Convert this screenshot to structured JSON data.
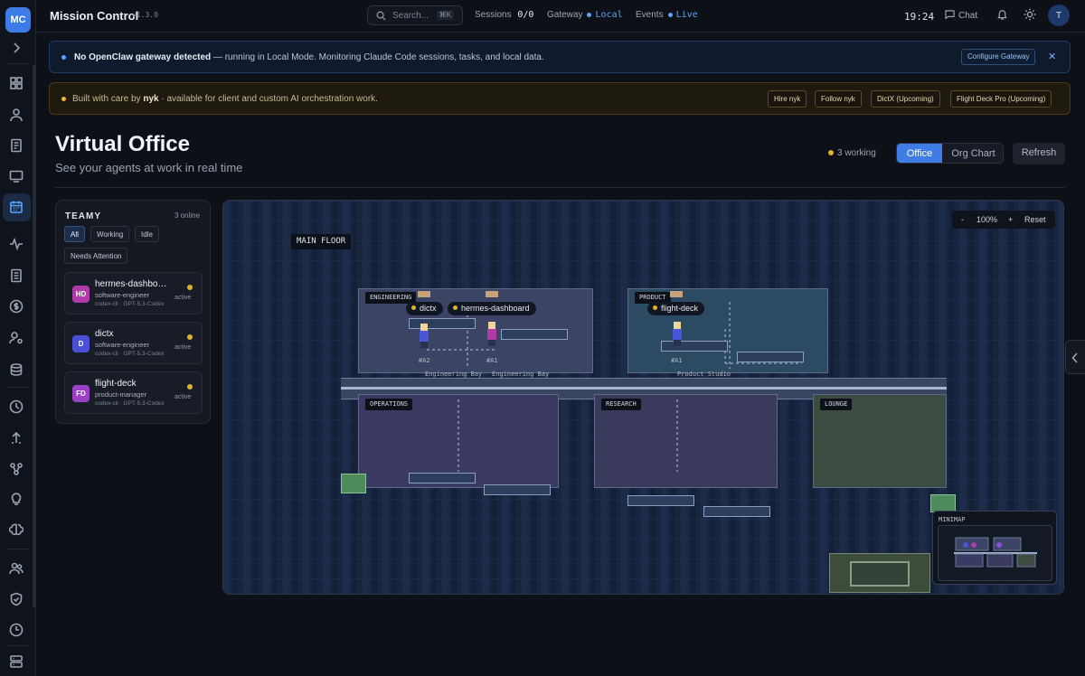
{
  "app": {
    "logo": "MC",
    "title": "Mission Control",
    "version": "v1.3.0"
  },
  "topbar": {
    "search_placeholder": "Search...",
    "search_shortcut": "⌘K",
    "sessions_label": "Sessions",
    "sessions_value": "0/0",
    "gateway_label": "Gateway",
    "gateway_value": "Local",
    "events_label": "Events",
    "events_value": "Live",
    "clock": "19:24",
    "chat_label": "Chat",
    "user_initial": "T"
  },
  "banner_gateway": {
    "title": "No OpenClaw gateway detected",
    "text": " — running in Local Mode. Monitoring Claude Code sessions, tasks, and local data.",
    "button": "Configure Gateway",
    "close": "✕"
  },
  "banner_credit": {
    "prefix": "Built with care by ",
    "author": "nyk",
    "suffix": " · available for client and custom AI orchestration work.",
    "buttons": [
      "Hire nyk",
      "Follow nyk",
      "DictX (Upcoming)",
      "Flight Deck Pro (Upcoming)"
    ]
  },
  "page": {
    "title": "Virtual Office",
    "subtitle": "See your agents at work in real time",
    "working": "3 working",
    "view_office": "Office",
    "view_org": "Org Chart",
    "refresh": "Refresh"
  },
  "team": {
    "title": "TEAMY",
    "online": "3 online",
    "filters": [
      "All",
      "Working",
      "Idle",
      "Needs Attention"
    ],
    "agents": [
      {
        "initials": "HD",
        "name": "hermes-dashboard",
        "role": "software-engineer",
        "meta": "codex-cli · GPT-5.3-Codex",
        "status": "active",
        "color": "#b03aa8"
      },
      {
        "initials": "D",
        "name": "dictx",
        "role": "software-engineer",
        "meta": "codex-cli · GPT-5.3-Codex",
        "status": "active",
        "color": "#4b4fd6"
      },
      {
        "initials": "FD",
        "name": "flight-deck",
        "role": "product-manager",
        "meta": "codex-cli · GPT-5.3-Codex",
        "status": "active",
        "color": "#9b3fc4"
      }
    ]
  },
  "office": {
    "zoom_minus": "-",
    "zoom_level": "100%",
    "zoom_plus": "+",
    "zoom_reset": "Reset",
    "floor": "MAIN FLOOR",
    "rooms": {
      "engineering": "ENGINEERING",
      "product": "PRODUCT",
      "operations": "OPERATIONS",
      "research": "RESEARCH",
      "lounge": "LOUNGE"
    },
    "area_labels": [
      "Engineering Bay",
      "Engineering Bay",
      "Product Studio"
    ],
    "agents": [
      {
        "name": "dictx",
        "desk": "#A2"
      },
      {
        "name": "hermes-dashboard",
        "desk": "#A1"
      },
      {
        "name": "flight-deck",
        "desk": "#A1"
      }
    ],
    "minimap_label": "MINIMAP"
  }
}
